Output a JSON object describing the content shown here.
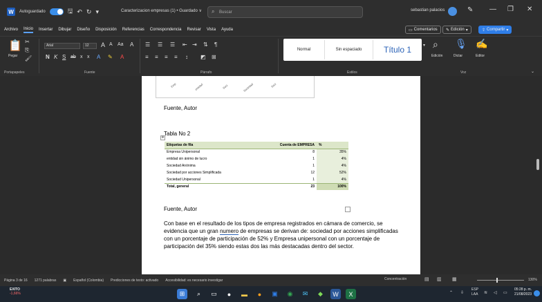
{
  "titlebar": {
    "autosave_label": "Autoguardado",
    "doc_title": "Caracterizacion empresas (1) • Guardado ∨",
    "search_placeholder": "Buscar",
    "user_name": "sebastian palacios"
  },
  "menu": {
    "items": [
      "Archivo",
      "Inicio",
      "Insertar",
      "Dibujar",
      "Diseño",
      "Disposición",
      "Referencias",
      "Correspondencia",
      "Revisar",
      "Vista",
      "Ayuda"
    ],
    "comments_label": "Comentarios",
    "edit_label": "Edición",
    "share_label": "Compartir"
  },
  "ribbon": {
    "paste_label": "Pegar",
    "font_name": "Arial",
    "font_size": "12",
    "group_labels": [
      "Portapapeles",
      "Fuente",
      "Párrafo",
      "Estilos",
      "Voz"
    ],
    "styles": [
      "Normal",
      "Sin espaciado",
      "Título 1"
    ],
    "edicion_label": "Edición",
    "dictar_label": "Dictar",
    "editor_label": "Editor"
  },
  "document": {
    "x_ticks": [
      "Emp",
      "entidad",
      "Soci",
      "Sociedad",
      "Soci"
    ],
    "caption_top": "Fuente, Autor",
    "table_title": "Tabla No 2",
    "pivot": {
      "headers": [
        "Etiquetas de fila",
        "Cuenta de EMPRESA",
        "%"
      ],
      "rows": [
        [
          "Empresa Unipersonal",
          "8",
          "35%"
        ],
        [
          "entidad sin ánimo de lucro",
          "1",
          "4%"
        ],
        [
          "Sociedad Anónima",
          "1",
          "4%"
        ],
        [
          "Sociedad por acciones Simplificada",
          "12",
          "52%"
        ],
        [
          "Sociedad Unipersonal",
          "1",
          "4%"
        ]
      ],
      "total": [
        "Total, general",
        "23",
        "100%"
      ]
    },
    "caption_bottom": "Fuente, Autor",
    "paragraph_pre": "Con base en el resultado de los tipos de empresa registrados en cámara de comercio, se evidencia que un gran ",
    "paragraph_hl": "numero",
    "paragraph_post": " de empresas se derivan de: sociedad por acciones simplificadas con un porcentaje de participación de 52% y Empresa unipersonal con un porcentaje de participación del 35% siendo estas dos las más destacadas dentro del sector."
  },
  "status": {
    "page": "Página 3 de 16",
    "words": "1271 palabras",
    "language": "Español (Colombia)",
    "predictions": "Predicciones de texto: activado",
    "accessibility": "Accesibilidad: es necesario investigar",
    "focus": "Concentración",
    "zoom": "130%"
  },
  "taskbar": {
    "stock_name": "EXITO",
    "stock_change": "-1,66%",
    "lang_line1": "ESP",
    "lang_line2": "LAA",
    "time": "05:28 p. m.",
    "date": "21/08/2023"
  }
}
